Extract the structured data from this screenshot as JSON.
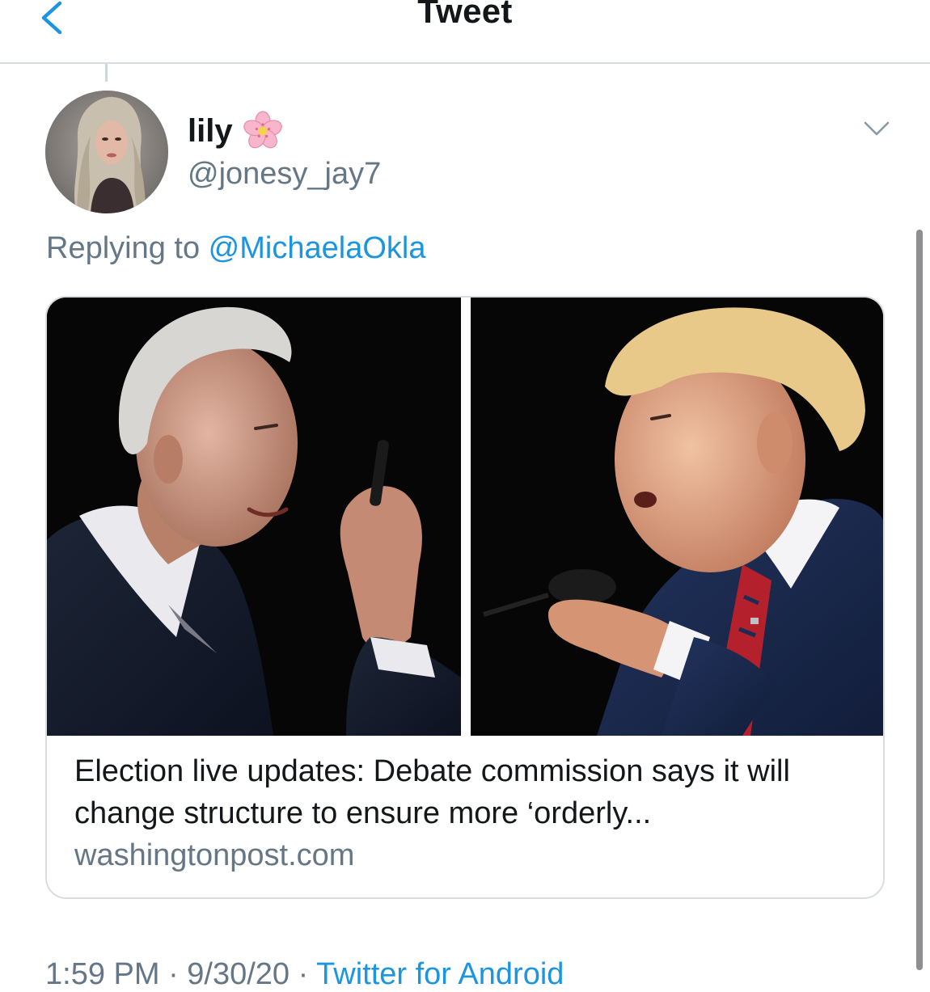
{
  "header": {
    "title": "Tweet",
    "back_icon": "chevron-left-icon",
    "accent": "#1b95e0"
  },
  "tweet": {
    "author": {
      "display_name": "lily",
      "emoji_icon": "cherry-blossom-icon",
      "handle": "@jonesy_jay7"
    },
    "more_icon": "chevron-down-icon",
    "reply_context": {
      "prefix": "Replying to ",
      "mention": "@MichaelaOkla"
    },
    "card": {
      "title": "Election live updates: Debate commission says it will change structure to ensure more ‘orderly...",
      "domain": "washingtonpost.com",
      "image_left_alt": "candidate-portrait-left",
      "image_right_alt": "candidate-portrait-right"
    },
    "meta": {
      "time_date": "1:59 PM · 9/30/20 · ",
      "source": "Twitter for Android"
    }
  },
  "colors": {
    "text_primary": "#14171a",
    "text_secondary": "#657786",
    "link": "#1b95e0",
    "border": "#d9dde1"
  }
}
